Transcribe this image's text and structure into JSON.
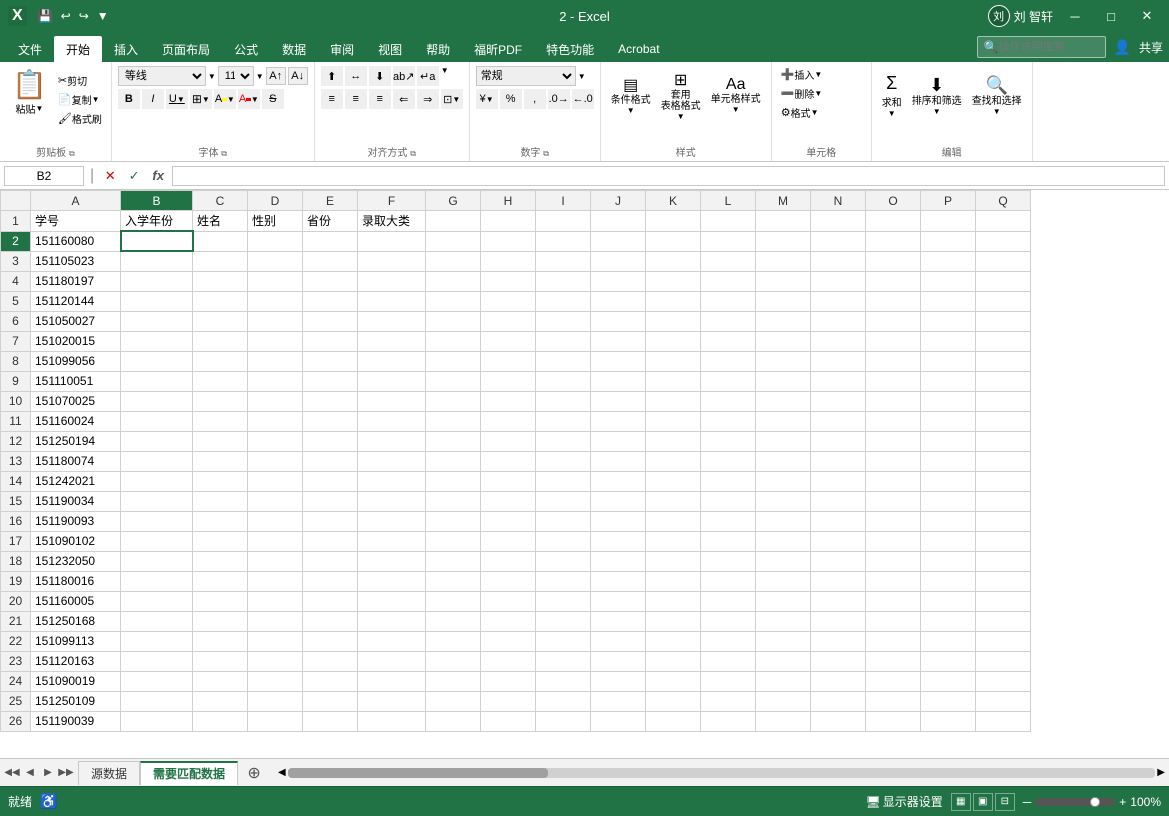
{
  "titlebar": {
    "title": "2 - Excel",
    "user": "刘 智轩",
    "quickaccess": [
      "save",
      "undo",
      "redo",
      "customize"
    ]
  },
  "ribbon": {
    "tabs": [
      "文件",
      "开始",
      "插入",
      "页面布局",
      "公式",
      "数据",
      "审阅",
      "视图",
      "帮助",
      "福昕PDF",
      "特色功能",
      "Acrobat"
    ],
    "active_tab": "开始",
    "share_label": "共享",
    "search_placeholder": "操作说明搜索",
    "groups": {
      "clipboard": {
        "label": "剪贴板",
        "paste": "粘贴",
        "cut": "剪切",
        "copy": "复制",
        "format_painter": "格式刷"
      },
      "font": {
        "label": "字体",
        "font_name": "等线",
        "font_size": "11",
        "bold": "B",
        "italic": "I",
        "underline": "U"
      },
      "alignment": {
        "label": "对齐方式"
      },
      "number": {
        "label": "数字",
        "format": "常规"
      },
      "styles": {
        "label": "样式",
        "conditional": "条件格式",
        "table": "套用\n表格格式",
        "cell_styles": "单元格样式"
      },
      "cells": {
        "label": "单元格",
        "insert": "插入",
        "delete": "删除",
        "format": "格式"
      },
      "editing": {
        "label": "编辑",
        "autosum": "排序和筛选",
        "fill": "查找和选择"
      }
    }
  },
  "formula_bar": {
    "name_box": "B2",
    "cancel": "✕",
    "confirm": "✓",
    "function": "fx"
  },
  "spreadsheet": {
    "columns": [
      "A",
      "B",
      "C",
      "D",
      "E",
      "F",
      "G",
      "H",
      "I",
      "J",
      "K",
      "L",
      "M",
      "N",
      "O",
      "P",
      "Q"
    ],
    "headers": [
      "学号",
      "入学年份",
      "姓名",
      "性别",
      "省份",
      "录取大类",
      "",
      "",
      "",
      "",
      "",
      "",
      "",
      "",
      "",
      "",
      ""
    ],
    "rows": [
      {
        "num": 1,
        "cells": [
          "学号",
          "入学年份",
          "姓名",
          "性别",
          "省份",
          "录取大类",
          "",
          "",
          "",
          "",
          "",
          "",
          "",
          "",
          "",
          "",
          ""
        ]
      },
      {
        "num": 2,
        "cells": [
          "151160080",
          "",
          "",
          "",
          "",
          "",
          "",
          "",
          "",
          "",
          "",
          "",
          "",
          "",
          "",
          "",
          ""
        ]
      },
      {
        "num": 3,
        "cells": [
          "151105023",
          "",
          "",
          "",
          "",
          "",
          "",
          "",
          "",
          "",
          "",
          "",
          "",
          "",
          "",
          "",
          ""
        ]
      },
      {
        "num": 4,
        "cells": [
          "151180197",
          "",
          "",
          "",
          "",
          "",
          "",
          "",
          "",
          "",
          "",
          "",
          "",
          "",
          "",
          "",
          ""
        ]
      },
      {
        "num": 5,
        "cells": [
          "151120144",
          "",
          "",
          "",
          "",
          "",
          "",
          "",
          "",
          "",
          "",
          "",
          "",
          "",
          "",
          "",
          ""
        ]
      },
      {
        "num": 6,
        "cells": [
          "151050027",
          "",
          "",
          "",
          "",
          "",
          "",
          "",
          "",
          "",
          "",
          "",
          "",
          "",
          "",
          "",
          ""
        ]
      },
      {
        "num": 7,
        "cells": [
          "151020015",
          "",
          "",
          "",
          "",
          "",
          "",
          "",
          "",
          "",
          "",
          "",
          "",
          "",
          "",
          "",
          ""
        ]
      },
      {
        "num": 8,
        "cells": [
          "151099056",
          "",
          "",
          "",
          "",
          "",
          "",
          "",
          "",
          "",
          "",
          "",
          "",
          "",
          "",
          "",
          ""
        ]
      },
      {
        "num": 9,
        "cells": [
          "151110051",
          "",
          "",
          "",
          "",
          "",
          "",
          "",
          "",
          "",
          "",
          "",
          "",
          "",
          "",
          "",
          ""
        ]
      },
      {
        "num": 10,
        "cells": [
          "151070025",
          "",
          "",
          "",
          "",
          "",
          "",
          "",
          "",
          "",
          "",
          "",
          "",
          "",
          "",
          "",
          ""
        ]
      },
      {
        "num": 11,
        "cells": [
          "151160024",
          "",
          "",
          "",
          "",
          "",
          "",
          "",
          "",
          "",
          "",
          "",
          "",
          "",
          "",
          "",
          ""
        ]
      },
      {
        "num": 12,
        "cells": [
          "151250194",
          "",
          "",
          "",
          "",
          "",
          "",
          "",
          "",
          "",
          "",
          "",
          "",
          "",
          "",
          "",
          ""
        ]
      },
      {
        "num": 13,
        "cells": [
          "151180074",
          "",
          "",
          "",
          "",
          "",
          "",
          "",
          "",
          "",
          "",
          "",
          "",
          "",
          "",
          "",
          ""
        ]
      },
      {
        "num": 14,
        "cells": [
          "151242021",
          "",
          "",
          "",
          "",
          "",
          "",
          "",
          "",
          "",
          "",
          "",
          "",
          "",
          "",
          "",
          ""
        ]
      },
      {
        "num": 15,
        "cells": [
          "151190034",
          "",
          "",
          "",
          "",
          "",
          "",
          "",
          "",
          "",
          "",
          "",
          "",
          "",
          "",
          "",
          ""
        ]
      },
      {
        "num": 16,
        "cells": [
          "151190093",
          "",
          "",
          "",
          "",
          "",
          "",
          "",
          "",
          "",
          "",
          "",
          "",
          "",
          "",
          "",
          ""
        ]
      },
      {
        "num": 17,
        "cells": [
          "151090102",
          "",
          "",
          "",
          "",
          "",
          "",
          "",
          "",
          "",
          "",
          "",
          "",
          "",
          "",
          "",
          ""
        ]
      },
      {
        "num": 18,
        "cells": [
          "151232050",
          "",
          "",
          "",
          "",
          "",
          "",
          "",
          "",
          "",
          "",
          "",
          "",
          "",
          "",
          "",
          ""
        ]
      },
      {
        "num": 19,
        "cells": [
          "151180016",
          "",
          "",
          "",
          "",
          "",
          "",
          "",
          "",
          "",
          "",
          "",
          "",
          "",
          "",
          "",
          ""
        ]
      },
      {
        "num": 20,
        "cells": [
          "151160005",
          "",
          "",
          "",
          "",
          "",
          "",
          "",
          "",
          "",
          "",
          "",
          "",
          "",
          "",
          "",
          ""
        ]
      },
      {
        "num": 21,
        "cells": [
          "151250168",
          "",
          "",
          "",
          "",
          "",
          "",
          "",
          "",
          "",
          "",
          "",
          "",
          "",
          "",
          "",
          ""
        ]
      },
      {
        "num": 22,
        "cells": [
          "151099113",
          "",
          "",
          "",
          "",
          "",
          "",
          "",
          "",
          "",
          "",
          "",
          "",
          "",
          "",
          "",
          ""
        ]
      },
      {
        "num": 23,
        "cells": [
          "151120163",
          "",
          "",
          "",
          "",
          "",
          "",
          "",
          "",
          "",
          "",
          "",
          "",
          "",
          "",
          "",
          ""
        ]
      },
      {
        "num": 24,
        "cells": [
          "151090019",
          "",
          "",
          "",
          "",
          "",
          "",
          "",
          "",
          "",
          "",
          "",
          "",
          "",
          "",
          "",
          ""
        ]
      },
      {
        "num": 25,
        "cells": [
          "151250109",
          "",
          "",
          "",
          "",
          "",
          "",
          "",
          "",
          "",
          "",
          "",
          "",
          "",
          "",
          "",
          ""
        ]
      },
      {
        "num": 26,
        "cells": [
          "151190039",
          "",
          "",
          "",
          "",
          "",
          "",
          "",
          "",
          "",
          "",
          "",
          "",
          "",
          "",
          "",
          ""
        ]
      }
    ],
    "active_cell": {
      "row": 2,
      "col": 1
    }
  },
  "sheets": {
    "tabs": [
      "源数据",
      "需要匹配数据"
    ],
    "active": "需要匹配数据"
  },
  "statusbar": {
    "mode": "就绪",
    "display_settings": "显示器设置",
    "zoom": "100%"
  }
}
